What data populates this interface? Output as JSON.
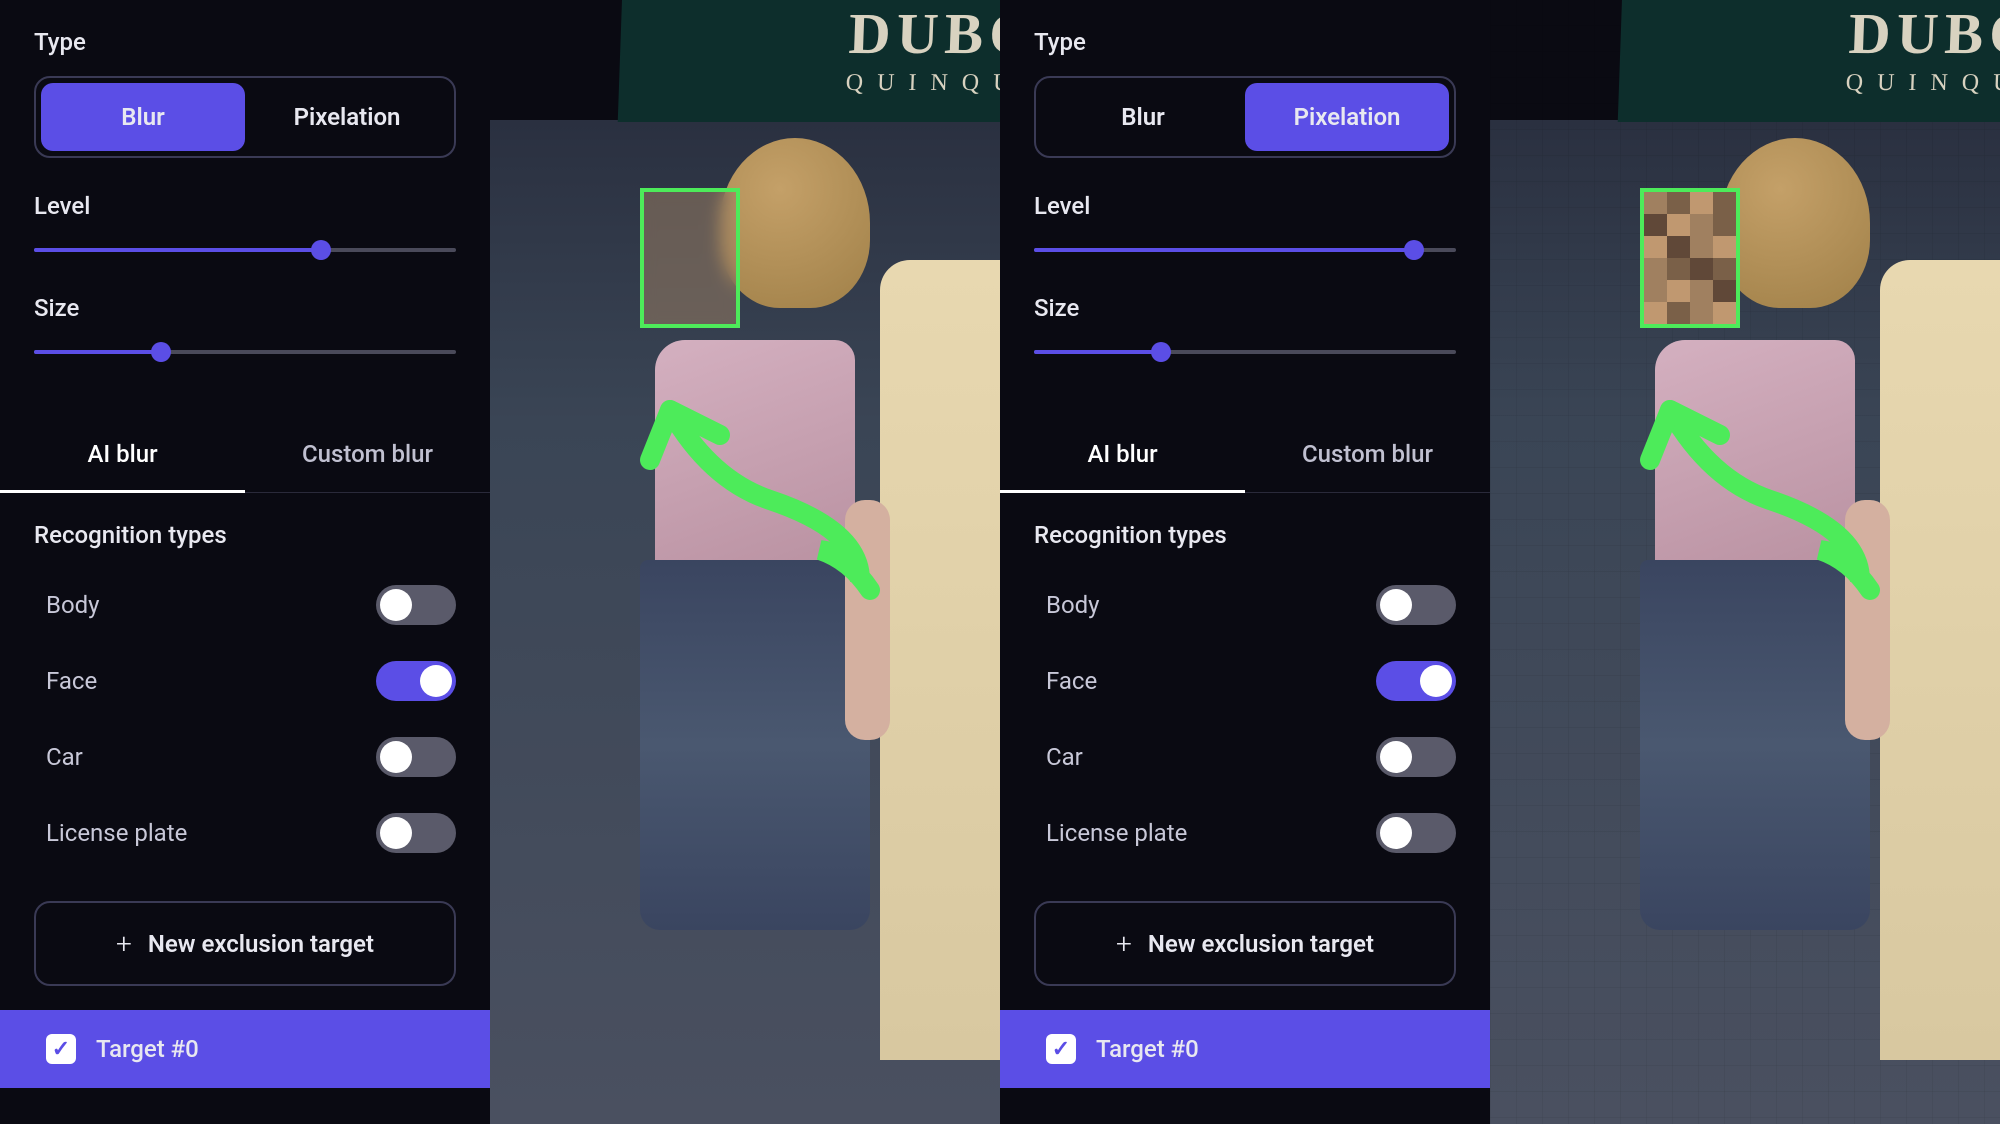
{
  "panels": [
    {
      "type_label": "Type",
      "blur_label": "Blur",
      "pixelation_label": "Pixelation",
      "active_type": "blur",
      "level_label": "Level",
      "level_pct": 68,
      "size_label": "Size",
      "size_pct": 30,
      "tabs": {
        "ai": "AI blur",
        "custom": "Custom blur",
        "active": "ai"
      },
      "recognition_title": "Recognition types",
      "recognition": [
        {
          "label": "Body",
          "on": false
        },
        {
          "label": "Face",
          "on": true
        },
        {
          "label": "Car",
          "on": false
        },
        {
          "label": "License plate",
          "on": false
        }
      ],
      "new_target": "New exclusion target",
      "target_name": "Target #0",
      "preview": {
        "sign_line1": "DUBONNE",
        "sign_line2": "QUINQUINA",
        "effect": "blur"
      }
    },
    {
      "type_label": "Type",
      "blur_label": "Blur",
      "pixelation_label": "Pixelation",
      "active_type": "pixelation",
      "level_label": "Level",
      "level_pct": 90,
      "size_label": "Size",
      "size_pct": 30,
      "tabs": {
        "ai": "AI blur",
        "custom": "Custom blur",
        "active": "ai"
      },
      "recognition_title": "Recognition types",
      "recognition": [
        {
          "label": "Body",
          "on": false
        },
        {
          "label": "Face",
          "on": true
        },
        {
          "label": "Car",
          "on": false
        },
        {
          "label": "License plate",
          "on": false
        }
      ],
      "new_target": "New exclusion target",
      "target_name": "Target #0",
      "preview": {
        "sign_line1": "DUBONNE",
        "sign_line2": "QUINQUINA",
        "effect": "pixelation"
      }
    }
  ],
  "colors": {
    "accent": "#5b4ee6",
    "highlight": "#4deb5a"
  }
}
